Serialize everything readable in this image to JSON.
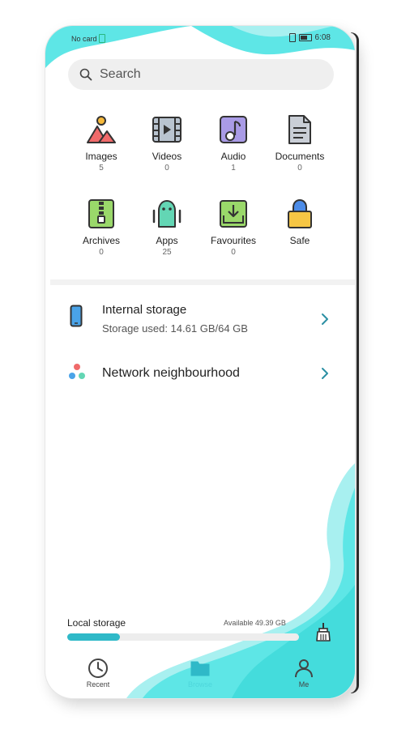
{
  "status_bar": {
    "carrier": "No card",
    "time": "6:08"
  },
  "search": {
    "placeholder": "Search"
  },
  "categories": [
    {
      "label": "Images",
      "count": "5",
      "icon": "images-icon"
    },
    {
      "label": "Videos",
      "count": "0",
      "icon": "videos-icon"
    },
    {
      "label": "Audio",
      "count": "1",
      "icon": "audio-icon"
    },
    {
      "label": "Documents",
      "count": "0",
      "icon": "documents-icon"
    },
    {
      "label": "Archives",
      "count": "0",
      "icon": "archives-icon"
    },
    {
      "label": "Apps",
      "count": "25",
      "icon": "apps-icon"
    },
    {
      "label": "Favourites",
      "count": "0",
      "icon": "favourites-icon"
    },
    {
      "label": "Safe",
      "count": "",
      "icon": "safe-icon"
    }
  ],
  "storage_items": [
    {
      "title": "Internal storage",
      "subtitle": "Storage used: 14.61 GB/64 GB",
      "icon": "phone-icon"
    },
    {
      "title": "Network neighbourhood",
      "icon": "network-icon"
    }
  ],
  "local_storage": {
    "label": "Local storage",
    "available": "Available 49.39 GB",
    "used_fraction": 0.228
  },
  "bottom_nav": [
    {
      "label": "Recent",
      "icon": "clock-icon"
    },
    {
      "label": "Browse",
      "icon": "folder-icon"
    },
    {
      "label": "Me",
      "icon": "person-icon"
    }
  ],
  "colors": {
    "accent": "#2fb9c8",
    "wave": "#5ee6e6",
    "wave_light": "#a8f0f0"
  }
}
